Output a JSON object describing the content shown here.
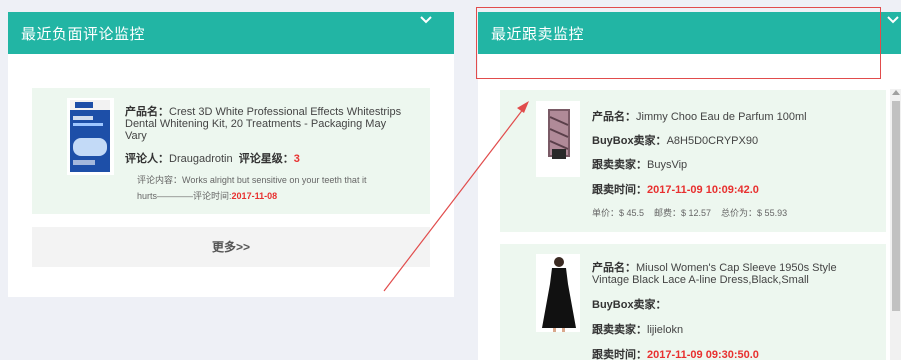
{
  "left_panel": {
    "title": "最近负面评论监控",
    "review": {
      "product_label": "产品名：",
      "product_name_line1": "Crest 3D White Professional Effects Whitestrips",
      "product_name_line2": "Dental Whitening Kit, 20 Treatments - Packaging May",
      "product_name_line3": "Vary",
      "reviewer_label": "评论人：",
      "reviewer": "Draugadrotin",
      "rating_label": "评论星级：",
      "rating": "3",
      "content_label": "评论内容：",
      "content_line1": "Works alright but sensitive on your teeth that it",
      "content_line2": "hurts",
      "time_label": "评论时间",
      "time": "2017-11-08"
    },
    "more_button": "更多>>"
  },
  "right_panel": {
    "title": "最近跟卖监控",
    "items": [
      {
        "product_label": "产品名：",
        "product_name_line1": "Jimmy Choo Eau de Parfum 100ml",
        "product_name_line2": "",
        "buybox_label": "BuyBox卖家：",
        "buybox_seller": "A8H5D0CRYPX90",
        "follower_label": "跟卖卖家：",
        "follower_seller": "BuysVip",
        "time_label": "跟卖时间：",
        "time": "2017-11-09 10:09:42.0",
        "price_line": "单价：$ 45.5    邮费：$ 12.57    总价为：$ 55.93"
      },
      {
        "product_label": "产品名：",
        "product_name_line1": "Miusol Women's Cap Sleeve 1950s Style",
        "product_name_line2": "Vintage Black Lace A-line Dress,Black,Small",
        "buybox_label": "BuyBox卖家：",
        "buybox_seller": "",
        "follower_label": "跟卖卖家：",
        "follower_seller": "lijielokn",
        "time_label": "跟卖时间：",
        "time": "2017-11-09 09:30:50.0"
      }
    ]
  },
  "icons": {
    "left_collapse": "chevron-down-icon",
    "right_collapse": "chevron-down-icon"
  },
  "colors": {
    "header": "#22b5a4",
    "card": "#edf7ef",
    "highlight": "#e8302f",
    "annotation": "#e14c4c"
  }
}
